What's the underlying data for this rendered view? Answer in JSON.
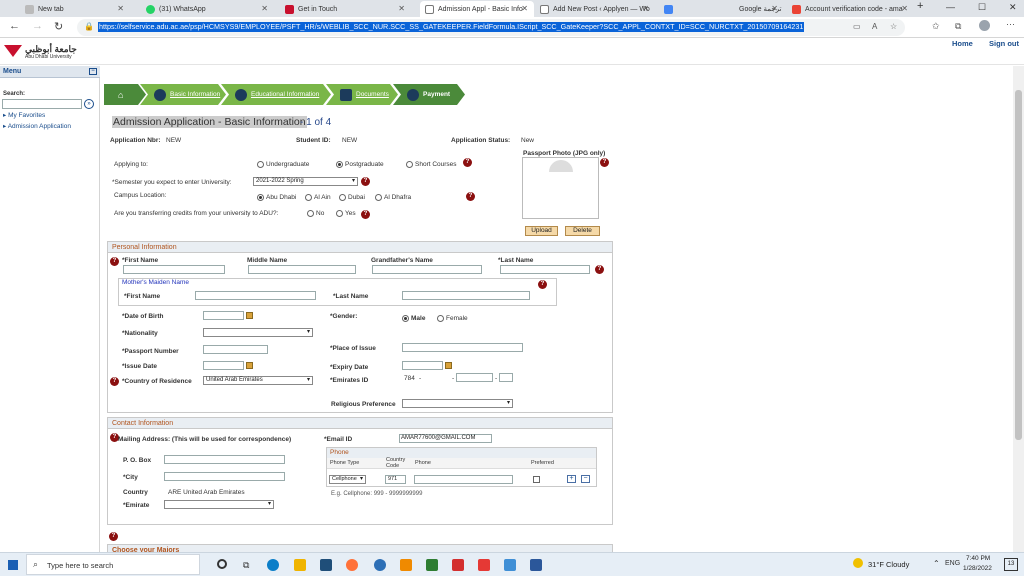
{
  "browser": {
    "tabs": [
      {
        "label": "New tab"
      },
      {
        "label": "(31) WhatsApp"
      },
      {
        "label": "Get in Touch"
      },
      {
        "label": "Admission Appl - Basic Info"
      },
      {
        "label": "Add New Post ‹ Applyen — Wo"
      },
      {
        "label": "Google ترجمة"
      },
      {
        "label": "Account verification code - ama"
      }
    ],
    "new_tab": "+",
    "url": "https://selfservice.adu.ac.ae/psp/HCMSYS9/EMPLOYEE/PSFT_HR/s/WEBLIB_SCC_NUR.SCC_SS_GATEKEEPER.FieldFormula.IScript_SCC_GateKeeper?SCC_APPL_CONTXT_ID=SCC_NURCTXT_20150709164231"
  },
  "header": {
    "logo_ar": "جامعة أبوظبي",
    "logo_en": "Abu Dhabi University",
    "home": "Home",
    "signout": "Sign out"
  },
  "sidebar": {
    "menu": "Menu",
    "search_label": "Search:",
    "items": [
      {
        "label": "My Favorites"
      },
      {
        "label": "Admission Application"
      }
    ]
  },
  "steps": [
    {
      "label": "Basic Information"
    },
    {
      "label": "Educational Information"
    },
    {
      "label": "Documents"
    },
    {
      "label": "Payment"
    }
  ],
  "page": {
    "title": "Admission Application - Basic Information",
    "page_of": "- 1 of 4",
    "app_nbr_label": "Application Nbr:",
    "app_nbr": "NEW",
    "student_id_label": "Student ID:",
    "student_id": "NEW",
    "status_label": "Application Status:",
    "status": "New"
  },
  "form": {
    "applying_to": "Applying to:",
    "undergrad": "Undergraduate",
    "postgrad": "Postgraduate",
    "short": "Short Courses",
    "semester_label": "*Semester you expect to enter University:",
    "semester_value": "2021-2022 Spring",
    "campus_label": "Campus Location:",
    "campus": [
      "Abu Dhabi",
      "Al Ain",
      "Dubai",
      "Al Dhafra"
    ],
    "transfer_label": "Are you transferring credits from your university to ADU?:",
    "no": "No",
    "yes": "Yes",
    "photo_label": "Passport Photo (JPG only)",
    "upload": "Upload",
    "delete": "Delete"
  },
  "personal": {
    "header": "Personal Information",
    "first": "*First Name",
    "middle": "Middle Name",
    "grandfather": "Grandfather's Name",
    "last": "*Last Name",
    "maiden": "Mother's Maiden Name",
    "m_first": "*First Name",
    "m_last": "*Last Name",
    "dob": "*Date of Birth",
    "gender": "*Gender:",
    "male": "Male",
    "female": "Female",
    "nationality": "*Nationality",
    "passport": "*Passport Number",
    "place_issue": "*Place of Issue",
    "issue_date": "*Issue Date",
    "expiry": "*Expiry Date",
    "country_res": "*Country of Residence",
    "country_value": "United Arab Emirates",
    "emirates_id": "*Emirates ID",
    "eid_prefix": "784",
    "dash": "-",
    "religious": "Religious Preference"
  },
  "contact": {
    "header": "Contact Information",
    "mailing": "Mailing Address: (This will be used for correspondence)",
    "email_label": "*Email ID",
    "email_value": "AMAR77600@GMAIL.COM",
    "pobox": "P. O. Box",
    "city": "*City",
    "country": "Country",
    "country_value": "ARE  United Arab Emirates",
    "emirate": "*Emirate",
    "phone_hdr": "Phone",
    "phone_type": "Phone Type",
    "country_code": "Country Code",
    "phone": "Phone",
    "preferred": "Preferred",
    "type_value": "Cellphone",
    "code_value": "971",
    "example": "E.g. Cellphone: 999 - 9999999999",
    "plus": "+",
    "minus": "−"
  },
  "majors": {
    "header": "Choose your Majors"
  },
  "taskbar": {
    "search": "Type here to search",
    "weather": "31°F  Cloudy",
    "lang": "ENG",
    "time": "7:40 PM",
    "date": "1/28/2022",
    "notif": "13"
  }
}
